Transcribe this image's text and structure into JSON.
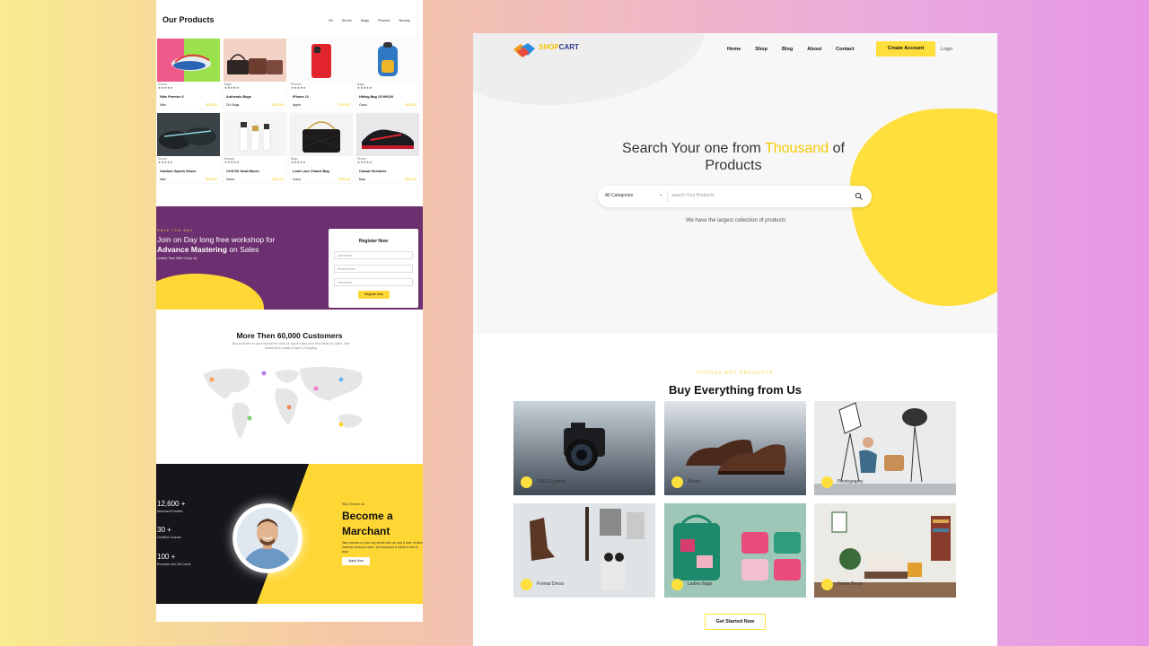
{
  "left_panel": {
    "products": {
      "title": "Our Products",
      "filters": [
        "All",
        "Shoes",
        "Bags",
        "Phones",
        "Beauty"
      ],
      "items": [
        {
          "category": "Shoes",
          "stars": "★★★★★",
          "name": "Nike Premier X",
          "brand": "Nike",
          "price": "$300.00"
        },
        {
          "category": "Bags",
          "stars": "★★★★★",
          "name": "Authentic Bags",
          "brand": "DLI Bags",
          "price": "$200.00"
        },
        {
          "category": "Phones",
          "stars": "★★★★★",
          "name": "iPhone 12",
          "brand": "Apple",
          "price": "$799.00"
        },
        {
          "category": "Bags",
          "stars": "★★★★★",
          "name": "Hiking Bag 15 NH100",
          "brand": "Gucci",
          "price": "$150.00"
        },
        {
          "category": "Shoes",
          "stars": "★★★★★",
          "name": "Outdoor Sports Shoes",
          "brand": "Nike",
          "price": "$250.00"
        },
        {
          "category": "Beauty",
          "stars": "★★★★★",
          "name": "COS RX Snail Mucin",
          "brand": "Zeera",
          "price": "$300.00"
        },
        {
          "category": "Bags",
          "stars": "★★★★★",
          "name": "Look Lace Chanel Bag",
          "brand": "Gucci",
          "price": "$700.00"
        },
        {
          "category": "Shoes",
          "stars": "★★★★★",
          "name": "Casual Sneakers",
          "brand": "Bata",
          "price": "$100.00"
        }
      ]
    },
    "workshop": {
      "kicker": "SAVE THE DAY",
      "line1": "Join on Day long free workshop for",
      "line2_bold": "Advance Mastering",
      "line2_rest": " on Sales",
      "note": "Limited Time Offer! Hurry Up",
      "form": {
        "title": "Register Now",
        "fields": [
          "Username",
          "Email/Phone",
          "Username"
        ],
        "button": "Register Now"
      }
    },
    "customers": {
      "title": "More Then 60,000 Customers",
      "subtitle": "Buy products on your any device with our app & enjoy your time what you want. Just download & install & start to shopping",
      "pin_colors": [
        "#f6a15a",
        "#b57cf2",
        "#6cb6f5",
        "#f07fd8",
        "#7ad36b",
        "#f0885a",
        "#ffd735"
      ]
    },
    "merchant": {
      "stats": [
        {
          "value": "12,600 +",
          "label": "Marchant Enrolled"
        },
        {
          "value": "30 +",
          "label": "Certified Courses"
        },
        {
          "value": "100 +",
          "label": "Rewards and Gift Cards"
        }
      ],
      "small": "Why Choose Us",
      "title_line1": "Become a",
      "title_line2": "Marchant",
      "desc": "Take courses on your any device with our app & learn all about business what you want. Just download & install & start to learn",
      "button": "Apply Now"
    }
  },
  "right_panel": {
    "logo": {
      "part1": "SHOP",
      "part2": "CART"
    },
    "nav": [
      "Home",
      "Shop",
      "Blog",
      "About",
      "Contact"
    ],
    "create_account": "Create Account",
    "login": "Login",
    "hero": {
      "title_pre": "Search Your one from ",
      "title_highlight": "Thousand",
      "title_post": " of",
      "title_line2": "Products",
      "category_select": "All Categories",
      "search_placeholder": "search Your Products",
      "subtitle": "We have the largest collection of products"
    },
    "categories": {
      "kicker": "CHOOSE ANY PRODUCTS",
      "title": "Buy Everything from Us",
      "items": [
        {
          "label": "DSLR Camera"
        },
        {
          "label": "Shoes"
        },
        {
          "label": "Photography"
        },
        {
          "label": "Formal Dress"
        },
        {
          "label": "Ladies Bags"
        },
        {
          "label": "Home Decor"
        }
      ],
      "button": "Get Started Now"
    },
    "colors": {
      "accent": "#fedf3c",
      "purple": "#6c2f6f",
      "dark": "#15151a"
    }
  }
}
